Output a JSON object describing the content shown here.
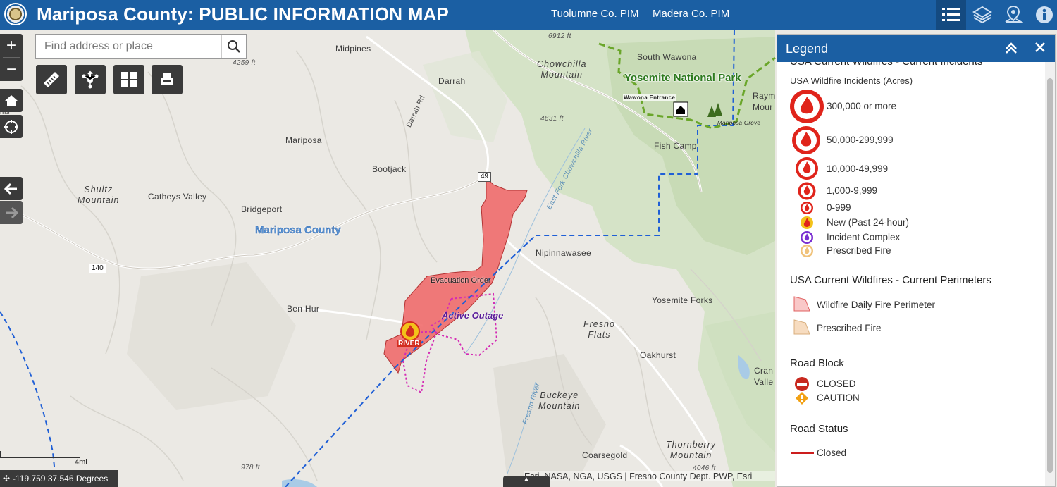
{
  "header": {
    "title": "Mariposa County: PUBLIC INFORMATION MAP",
    "links": [
      "Tuolumne Co. PIM",
      "Madera Co. PIM"
    ],
    "buttons": [
      "list-icon",
      "layers-icon",
      "map-pin-icon",
      "info-icon"
    ]
  },
  "search": {
    "placeholder": "Find address or place"
  },
  "map": {
    "places": {
      "midpines": "Midpines",
      "darrah": "Darrah",
      "mariposa": "Mariposa",
      "bootjack": "Bootjack",
      "catheys_valley": "Catheys Valley",
      "bridgeport": "Bridgeport",
      "ben_hur": "Ben Hur",
      "nipinnawasee": "Nipinnawasee",
      "south_wawona": "South Wawona",
      "fish_camp": "Fish Camp",
      "yosemite_forks": "Yosemite Forks",
      "oakhurst": "Oakhurst",
      "coarsegold": "Coarsegold",
      "raym": "Raym",
      "mour": "Mour",
      "cran": "Cran",
      "valle": "Valle",
      "ms": "ms"
    },
    "mountains": {
      "chowchilla": "Chowchilla\nMountain",
      "shultz": "Shultz\nMountain",
      "fresno_flats": "Fresno\nFlats",
      "buckeye": "Buckeye\nMountain",
      "thornberry": "Thornberry\nMountain"
    },
    "elevations": [
      "6912 ft",
      "4259 ft",
      "4631 ft",
      "978 ft",
      "4046 ft"
    ],
    "roads": {
      "darrah_rd": "Darrah Rd",
      "hwy49": "49",
      "hwy140": "140"
    },
    "water": {
      "east_fork": "East Fork Chowchilla River",
      "fresno_river": "Fresno River"
    },
    "county_label": "Mariposa County",
    "park_label": "Yosemite National Park",
    "wawona_entrance": "Wawona Entrance",
    "mariposa_grove": "Mariposa Grove",
    "evacuation_order": "Evacuation Order",
    "active_outage": "Active Outage",
    "fire_label": "RIVER",
    "scale": "4mi",
    "coordinates": "-119.759 37.546 Degrees",
    "attribution": "Esri, NASA, NGA, USGS | Fresno County Dept. PWP, Esri"
  },
  "legend": {
    "title": "Legend",
    "incidents_header": "USA Current Wildfires - Current Incidents",
    "incidents_sub": "USA Wildfire Incidents (Acres)",
    "incident_classes": [
      "300,000 or more",
      "50,000-299,999",
      "10,000-49,999",
      "1,000-9,999",
      "0-999",
      "New (Past 24-hour)",
      "Incident Complex",
      "Prescribed Fire"
    ],
    "perimeters_header": "USA Current Wildfires - Current Perimeters",
    "perimeter_classes": [
      "Wildfire Daily Fire Perimeter",
      "Prescribed Fire"
    ],
    "roadblock_header": "Road Block",
    "roadblock_classes": [
      "CLOSED",
      "CAUTION"
    ],
    "roadstatus_header": "Road Status",
    "roadstatus_classes": [
      "Closed"
    ]
  },
  "colors": {
    "header": "#1b5fa3",
    "fire_perimeter": "#f06b6b",
    "county_boundary": "#1f5fd6",
    "park_boundary": "#6aa62a",
    "outage": "#d42bb4",
    "closed_road": "#cc1d1d"
  }
}
